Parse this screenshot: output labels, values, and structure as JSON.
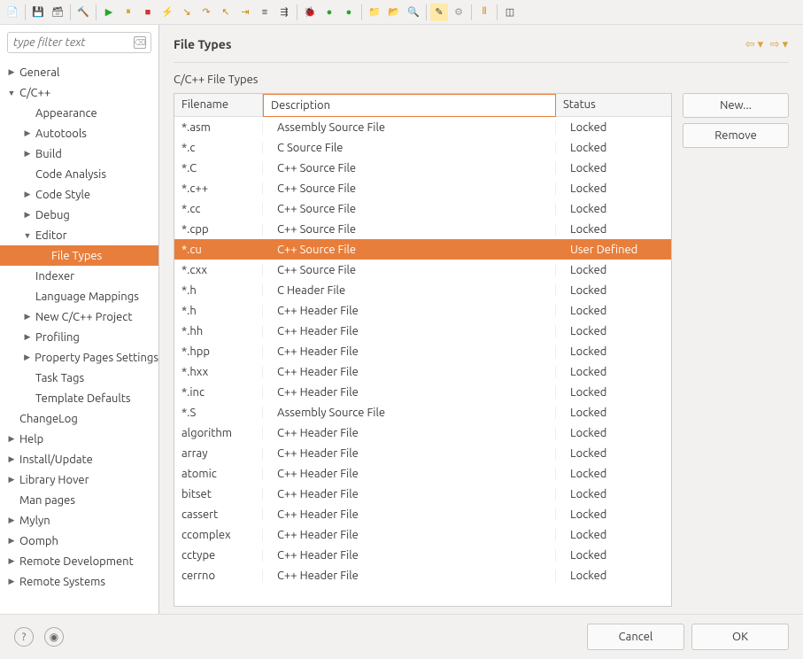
{
  "filter": {
    "placeholder": "type filter text"
  },
  "tree": [
    {
      "label": "General",
      "indent": 0,
      "arrow": "▶"
    },
    {
      "label": "C/C++",
      "indent": 0,
      "arrow": "▼"
    },
    {
      "label": "Appearance",
      "indent": 1,
      "arrow": ""
    },
    {
      "label": "Autotools",
      "indent": 1,
      "arrow": "▶"
    },
    {
      "label": "Build",
      "indent": 1,
      "arrow": "▶"
    },
    {
      "label": "Code Analysis",
      "indent": 1,
      "arrow": ""
    },
    {
      "label": "Code Style",
      "indent": 1,
      "arrow": "▶"
    },
    {
      "label": "Debug",
      "indent": 1,
      "arrow": "▶"
    },
    {
      "label": "Editor",
      "indent": 1,
      "arrow": "▼"
    },
    {
      "label": "File Types",
      "indent": 2,
      "arrow": "",
      "selected": true
    },
    {
      "label": "Indexer",
      "indent": 1,
      "arrow": ""
    },
    {
      "label": "Language Mappings",
      "indent": 1,
      "arrow": ""
    },
    {
      "label": "New C/C++ Project",
      "indent": 1,
      "arrow": "▶"
    },
    {
      "label": "Profiling",
      "indent": 1,
      "arrow": "▶"
    },
    {
      "label": "Property Pages Settings",
      "indent": 1,
      "arrow": "▶"
    },
    {
      "label": "Task Tags",
      "indent": 1,
      "arrow": ""
    },
    {
      "label": "Template Defaults",
      "indent": 1,
      "arrow": ""
    },
    {
      "label": "ChangeLog",
      "indent": 0,
      "arrow": ""
    },
    {
      "label": "Help",
      "indent": 0,
      "arrow": "▶"
    },
    {
      "label": "Install/Update",
      "indent": 0,
      "arrow": "▶"
    },
    {
      "label": "Library Hover",
      "indent": 0,
      "arrow": "▶"
    },
    {
      "label": "Man pages",
      "indent": 0,
      "arrow": ""
    },
    {
      "label": "Mylyn",
      "indent": 0,
      "arrow": "▶"
    },
    {
      "label": "Oomph",
      "indent": 0,
      "arrow": "▶"
    },
    {
      "label": "Remote Development",
      "indent": 0,
      "arrow": "▶"
    },
    {
      "label": "Remote Systems",
      "indent": 0,
      "arrow": "▶"
    }
  ],
  "page": {
    "title": "File Types",
    "section": "C/C++ File Types"
  },
  "table": {
    "headers": {
      "filename": "Filename",
      "description": "Description",
      "status": "Status"
    },
    "rows": [
      {
        "filename": "*.asm",
        "description": "Assembly Source File",
        "status": "Locked"
      },
      {
        "filename": "*.c",
        "description": "C Source File",
        "status": "Locked"
      },
      {
        "filename": "*.C",
        "description": "C++ Source File",
        "status": "Locked"
      },
      {
        "filename": "*.c++",
        "description": "C++ Source File",
        "status": "Locked"
      },
      {
        "filename": "*.cc",
        "description": "C++ Source File",
        "status": "Locked"
      },
      {
        "filename": "*.cpp",
        "description": "C++ Source File",
        "status": "Locked"
      },
      {
        "filename": "*.cu",
        "description": "C++ Source File",
        "status": "User Defined",
        "selected": true
      },
      {
        "filename": "*.cxx",
        "description": "C++ Source File",
        "status": "Locked"
      },
      {
        "filename": "*.h",
        "description": "C Header File",
        "status": "Locked"
      },
      {
        "filename": "*.h",
        "description": "C++ Header File",
        "status": "Locked"
      },
      {
        "filename": "*.hh",
        "description": "C++ Header File",
        "status": "Locked"
      },
      {
        "filename": "*.hpp",
        "description": "C++ Header File",
        "status": "Locked"
      },
      {
        "filename": "*.hxx",
        "description": "C++ Header File",
        "status": "Locked"
      },
      {
        "filename": "*.inc",
        "description": "C++ Header File",
        "status": "Locked"
      },
      {
        "filename": "*.S",
        "description": "Assembly Source File",
        "status": "Locked"
      },
      {
        "filename": "algorithm",
        "description": "C++ Header File",
        "status": "Locked"
      },
      {
        "filename": "array",
        "description": "C++ Header File",
        "status": "Locked"
      },
      {
        "filename": "atomic",
        "description": "C++ Header File",
        "status": "Locked"
      },
      {
        "filename": "bitset",
        "description": "C++ Header File",
        "status": "Locked"
      },
      {
        "filename": "cassert",
        "description": "C++ Header File",
        "status": "Locked"
      },
      {
        "filename": "ccomplex",
        "description": "C++ Header File",
        "status": "Locked"
      },
      {
        "filename": "cctype",
        "description": "C++ Header File",
        "status": "Locked"
      },
      {
        "filename": "cerrno",
        "description": "C++ Header File",
        "status": "Locked"
      }
    ]
  },
  "buttons": {
    "new": "New...",
    "remove": "Remove",
    "cancel": "Cancel",
    "ok": "OK"
  }
}
